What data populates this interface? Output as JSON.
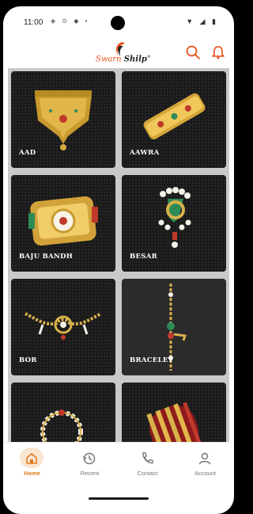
{
  "status_bar": {
    "time": "11:00"
  },
  "header": {
    "logo_text_1": "Swarn",
    "logo_text_2": "Shilp",
    "logo_mark": "®"
  },
  "colors": {
    "accent": "#e07a1f",
    "brand": "#e8501a",
    "card_bg": "#1a1a1a"
  },
  "categories": [
    {
      "label": "AAD",
      "icon": "gold-necklace-image"
    },
    {
      "label": "AAWRA",
      "icon": "gold-bangle-image"
    },
    {
      "label": "BAJU BANDH",
      "icon": "armlet-image"
    },
    {
      "label": "BESAR",
      "icon": "nose-pin-image"
    },
    {
      "label": "BOR",
      "icon": "necklace-chain-image"
    },
    {
      "label": "BRACELET",
      "icon": "bracelet-image"
    },
    {
      "label": "",
      "icon": "nose-ring-image"
    },
    {
      "label": "",
      "icon": "bangles-set-image"
    }
  ],
  "bottom_nav": [
    {
      "label": "Home",
      "icon": "home-icon",
      "active": true
    },
    {
      "label": "Recent",
      "icon": "history-icon",
      "active": false
    },
    {
      "label": "Contact",
      "icon": "phone-icon",
      "active": false
    },
    {
      "label": "Account",
      "icon": "user-icon",
      "active": false
    }
  ]
}
